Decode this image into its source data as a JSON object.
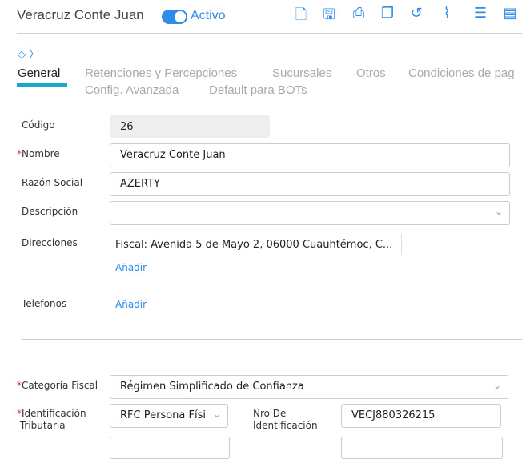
{
  "header": {
    "title": "Veracruz Conte Juan",
    "status": "Activo",
    "active": true
  },
  "toolbar": [
    "new-document",
    "save",
    "print",
    "copy",
    "history",
    "attach",
    "checklist",
    "report"
  ],
  "tabs": [
    "General",
    "Retenciones y Percepciones",
    "Sucursales",
    "Otros",
    "Condiciones de pag",
    "Config. Avanzada",
    "Default para BOTs"
  ],
  "form": {
    "codigo_label": "Código",
    "codigo": "26",
    "nombre_label": "Nombre",
    "nombre": "Veracruz Conte Juan",
    "razon_label": "Razón Social",
    "razon": "AZERTY",
    "desc_label": "Descripción",
    "desc": "",
    "dir_label": "Direcciones",
    "direccion": "Fiscal: Avenida 5 de Mayo 2, 06000 Cuauhtémoc, C...",
    "add": "Añadir",
    "tel_label": "Telefonos",
    "cat_label": "Categoría Fiscal",
    "cat": "Régimen Simplificado de Confianza",
    "idtrib_label1": "Identificación",
    "idtrib_label2": "Tributaria",
    "idtrib": "RFC Persona Físi",
    "nro_label1": "Nro De",
    "nro_label2": "Identificación",
    "nro": "VECJ880326215"
  }
}
